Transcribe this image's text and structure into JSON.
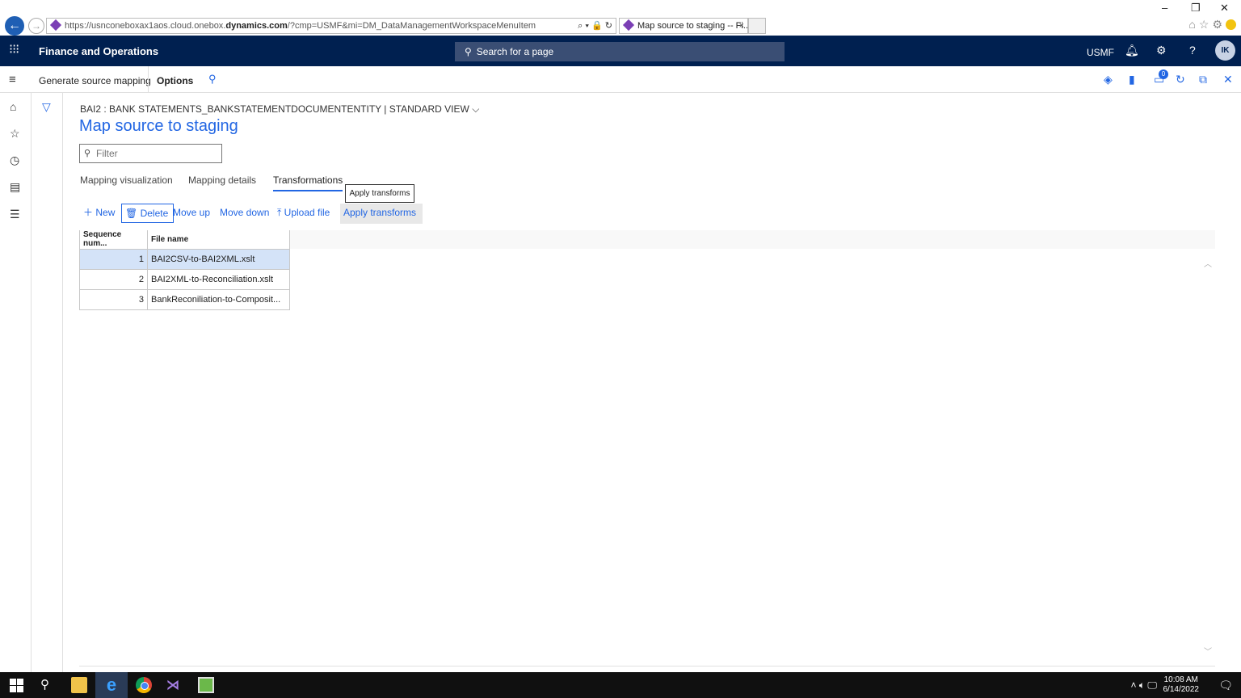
{
  "browser": {
    "url_prefix": "https://usnconeboxax1aos.cloud.onebox.",
    "url_domain": "dynamics.com",
    "url_suffix": "/?cmp=USMF&mi=DM_DataManagementWorkspaceMenuItem",
    "tab_title": "Map source to staging -- Fi...",
    "address_icons": "⌕ ▾ 🔒 ↻"
  },
  "navbar": {
    "app_title": "Finance and Operations",
    "search_placeholder": "Search for a page",
    "company": "USMF",
    "user_initials": "IK"
  },
  "action_pane": {
    "generate_label": "Generate source mapping",
    "options_label": "Options",
    "notification_count": "0"
  },
  "page": {
    "breadcrumb": "BAI2 : BANK STATEMENTS_BANKSTATEMENTDOCUMENTENTITY  |  STANDARD VIEW",
    "title": "Map source to staging",
    "filter_placeholder": "Filter"
  },
  "tabs": [
    {
      "label": "Mapping visualization"
    },
    {
      "label": "Mapping details"
    },
    {
      "label": "Transformations"
    }
  ],
  "tooltip": "Apply transforms",
  "toolbar": {
    "new_label": "New",
    "delete_label": "Delete",
    "move_up_label": "Move up",
    "move_down_label": "Move down",
    "upload_label": "Upload file",
    "apply_label": "Apply transforms"
  },
  "grid": {
    "columns": [
      "Sequence num...",
      "File name"
    ],
    "rows": [
      {
        "seq": "1",
        "file": "BAI2CSV-to-BAI2XML.xslt",
        "selected": true
      },
      {
        "seq": "2",
        "file": "BAI2XML-to-Reconciliation.xslt",
        "selected": false
      },
      {
        "seq": "3",
        "file": "BankReconiliation-to-Composit...",
        "selected": false
      }
    ]
  },
  "taskbar": {
    "time": "10:08 AM",
    "date": "6/14/2022"
  },
  "colors": {
    "accent": "#2266e3",
    "navbar": "#002050",
    "selected_row": "#d4e3f8"
  }
}
